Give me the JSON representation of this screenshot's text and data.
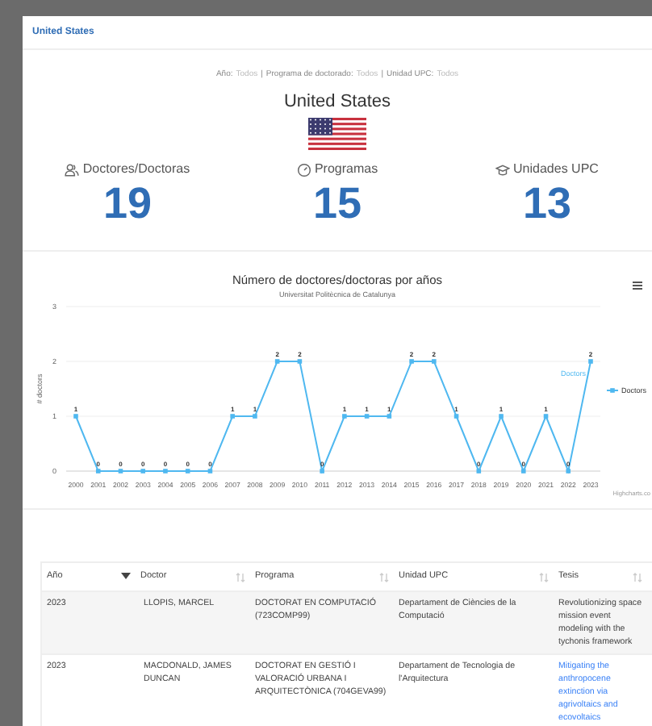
{
  "modal": {
    "title": "United States"
  },
  "filters": [
    {
      "label": "Año:",
      "value": "Todos"
    },
    {
      "separator": "|",
      "label": "Programa de doctorado:",
      "value": "Todos"
    },
    {
      "separator": "|",
      "label": "Unidad UPC:",
      "value": "Todos"
    }
  ],
  "country": "United States",
  "stats": [
    {
      "kind": "people",
      "label": "Doctores/Doctoras",
      "value": "19"
    },
    {
      "kind": "gauge",
      "label": "Programas",
      "value": "15"
    },
    {
      "kind": "cap",
      "label": "Unidades UPC",
      "value": "13"
    }
  ],
  "chart": {
    "chart_data": {
      "type": "line",
      "title": "Número de doctores/doctoras por años",
      "subtitle": "Universitat Politècnica de Catalunya",
      "ylabel": "# doctors",
      "categories": [
        "2000",
        "2001",
        "2002",
        "2003",
        "2004",
        "2005",
        "2006",
        "2007",
        "2008",
        "2009",
        "2010",
        "2011",
        "2012",
        "2013",
        "2014",
        "2015",
        "2016",
        "2017",
        "2018",
        "2019",
        "2020",
        "2021",
        "2022",
        "2023"
      ],
      "series": [
        {
          "name": "Doctors",
          "color": "#4fb8f0",
          "marker": true,
          "values": [
            1,
            0,
            0,
            0,
            0,
            0,
            0,
            1,
            1,
            2,
            2,
            0,
            1,
            1,
            1,
            2,
            2,
            1,
            0,
            1,
            0,
            1,
            0,
            2
          ]
        }
      ],
      "ylim": [
        0,
        3
      ],
      "yticks": [
        0,
        1,
        2,
        3
      ],
      "data_labels": true,
      "legend": true
    },
    "series_label": "Doctors",
    "credits": "Highcharts.co"
  },
  "table": {
    "columns": [
      {
        "label": "Año",
        "sorted": true
      },
      {
        "label": "Doctor",
        "sorted": false
      },
      {
        "label": "Programa",
        "sorted": false
      },
      {
        "label": "Unidad UPC",
        "sorted": false
      },
      {
        "label": "Tesis",
        "sorted": false
      }
    ],
    "rows": [
      {
        "cells": [
          "2023",
          "LLOPIS, MARCEL",
          "DOCTORAT EN COMPUTACIÓ (723COMP99)",
          "Departament de Ciències de la Computació",
          "Revolutionizing space mission event modeling with the tychonis framework"
        ],
        "thesis_link": false
      },
      {
        "cells": [
          "2023",
          "MACDONALD, JAMES DUNCAN",
          "DOCTORAT EN GESTIÓ I VALORACIÓ URBANA I ARQUITECTÒNICA (704GEVA99)",
          "Departament de Tecnologia de l'Arquitectura",
          "Mitigating the anthropocene extinction via agrivoltaics and ecovoltaics"
        ],
        "thesis_link": true
      }
    ]
  }
}
